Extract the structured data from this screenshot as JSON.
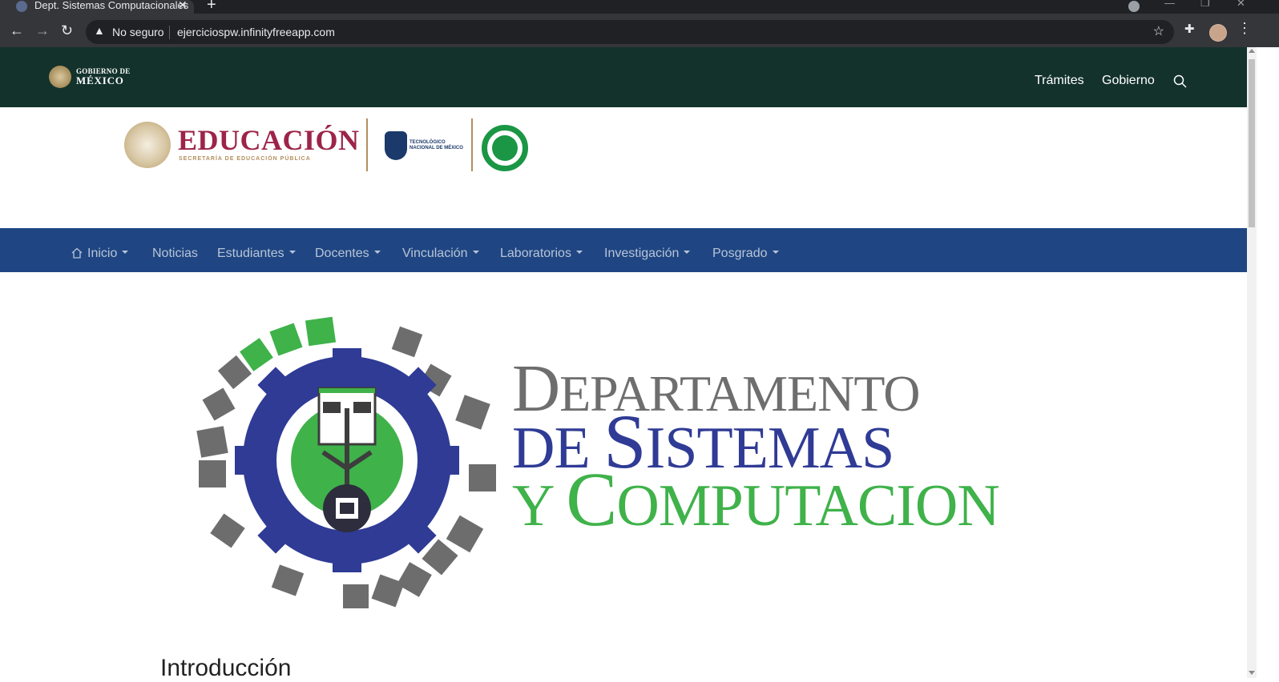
{
  "browser": {
    "tab_title": "Dept. Sistemas Computacionales",
    "security_label": "No seguro",
    "url": "ejerciciospw.infinityfreeapp.com"
  },
  "gov_header": {
    "brand_small": "GOBIERNO DE",
    "brand_big": "MÉXICO",
    "links": [
      "Trámites",
      "Gobierno"
    ]
  },
  "logos": {
    "education_title": "EDUCACIÓN",
    "education_subtitle": "SECRETARÍA DE EDUCACIÓN PÚBLICA",
    "tecnm_line1": "TECNOLÓGICO",
    "tecnm_line2": "NACIONAL DE MÉXICO"
  },
  "main_nav": {
    "items": [
      {
        "label": "Inicio",
        "dropdown": true
      },
      {
        "label": "Noticias",
        "dropdown": false
      },
      {
        "label": "Estudiantes",
        "dropdown": true
      },
      {
        "label": "Docentes",
        "dropdown": true
      },
      {
        "label": "Vinculación",
        "dropdown": true
      },
      {
        "label": "Laboratorios",
        "dropdown": true
      },
      {
        "label": "Investigación",
        "dropdown": true
      },
      {
        "label": "Posgrado",
        "dropdown": true
      }
    ]
  },
  "banner": {
    "line1_initial": "D",
    "line1_rest": "EPARTAMENTO",
    "line2_prefix": "DE ",
    "line2_initial": "S",
    "line2_rest": "ISTEMAS",
    "line3_prefix": "Y ",
    "line3_initial": "C",
    "line3_rest": "OMPUTACION"
  },
  "content": {
    "heading_partial": "Introducción"
  },
  "colors": {
    "gov_green": "#13322b",
    "nav_blue": "#1f4682",
    "edu_maroon": "#9d2449",
    "gold": "#b38e5d",
    "dept_gray": "#6e6e6e",
    "dept_blue": "#2f3b95",
    "dept_green": "#3fb24a"
  },
  "icons": [
    "back-arrow-icon",
    "forward-arrow-icon",
    "reload-icon",
    "warning-icon",
    "star-icon",
    "extensions-icon",
    "menu-dots-icon",
    "search-icon",
    "home-icon",
    "caret-down-icon",
    "close-icon",
    "plus-icon"
  ]
}
